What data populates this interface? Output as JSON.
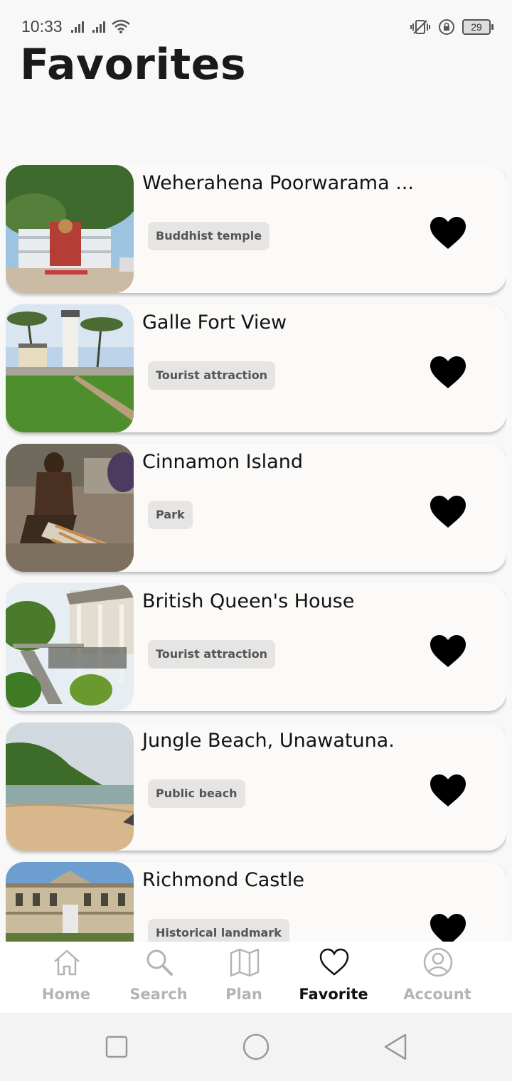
{
  "status_bar": {
    "time": "10:33",
    "battery": "29",
    "icons": [
      "signal-icon",
      "signal-icon",
      "wifi-icon",
      "vibrate-icon",
      "rotation-lock-icon",
      "battery-icon"
    ]
  },
  "page": {
    "title": "Favorites"
  },
  "favorites": [
    {
      "name": "Weherahena Poorwarama ...",
      "category": "Buddhist temple",
      "favorited": true
    },
    {
      "name": "Galle Fort View",
      "category": "Tourist attraction",
      "favorited": true
    },
    {
      "name": "Cinnamon Island",
      "category": "Park",
      "favorited": true
    },
    {
      "name": "British Queen's House",
      "category": "Tourist attraction",
      "favorited": true
    },
    {
      "name": "Jungle Beach, Unawatuna.",
      "category": "Public beach",
      "favorited": true
    },
    {
      "name": "Richmond Castle",
      "category": "Historical landmark",
      "favorited": true
    }
  ],
  "bottom_nav": {
    "active": "Favorite",
    "items": [
      {
        "label": "Home",
        "icon": "home-icon"
      },
      {
        "label": "Search",
        "icon": "search-icon"
      },
      {
        "label": "Plan",
        "icon": "map-icon"
      },
      {
        "label": "Favorite",
        "icon": "heart-icon"
      },
      {
        "label": "Account",
        "icon": "account-icon"
      }
    ]
  },
  "system_nav": {
    "icons": [
      "recents-icon",
      "home-circle-icon",
      "back-icon"
    ]
  },
  "colors": {
    "background": "#f8f8f8",
    "card": "#fbfaf9",
    "chip": "#e6e5e4",
    "inactive": "#b4b4b4",
    "active": "#111111"
  }
}
